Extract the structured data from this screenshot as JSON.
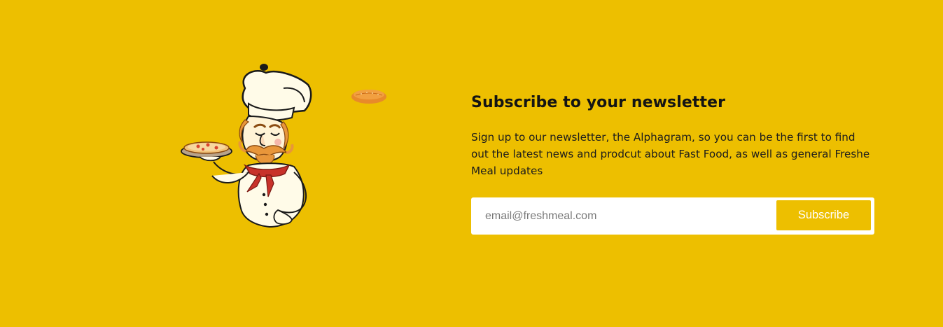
{
  "newsletter": {
    "title": "Subscribe to your newsletter",
    "description": "Sign up to our newsletter, the Alphagram, so you can be the first to find out the latest news and prodcut about Fast Food, as well as general Freshe Meal updates",
    "email_placeholder": "email@freshmeal.com",
    "email_value": "",
    "subscribe_label": "Subscribe"
  },
  "colors": {
    "background": "#edbf00",
    "button": "#edbf00",
    "button_text": "#ffffff",
    "input_bg": "#ffffff",
    "title_text": "#141414"
  },
  "images": {
    "illustration": "chef-holding-pizza-icon",
    "floating_item": "bread-icon"
  }
}
